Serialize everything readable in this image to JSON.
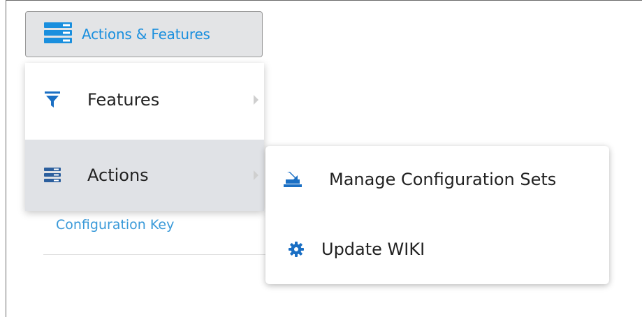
{
  "toolbar": {
    "button_label": "Actions & Features",
    "button_icon": "server-stack-icon",
    "accent": "#1a8fde"
  },
  "menu": {
    "items": [
      {
        "label": "Features",
        "icon": "funnel-icon",
        "has_submenu": true,
        "active": false
      },
      {
        "label": "Actions",
        "icon": "list-settings-icon",
        "has_submenu": true,
        "active": true
      }
    ]
  },
  "background": {
    "field_label": "Configuration Key"
  },
  "submenu": {
    "items": [
      {
        "label": "Manage Configuration Sets",
        "icon": "manage-config-icon"
      },
      {
        "label": "Update WIKI",
        "icon": "gear-icon"
      }
    ]
  }
}
